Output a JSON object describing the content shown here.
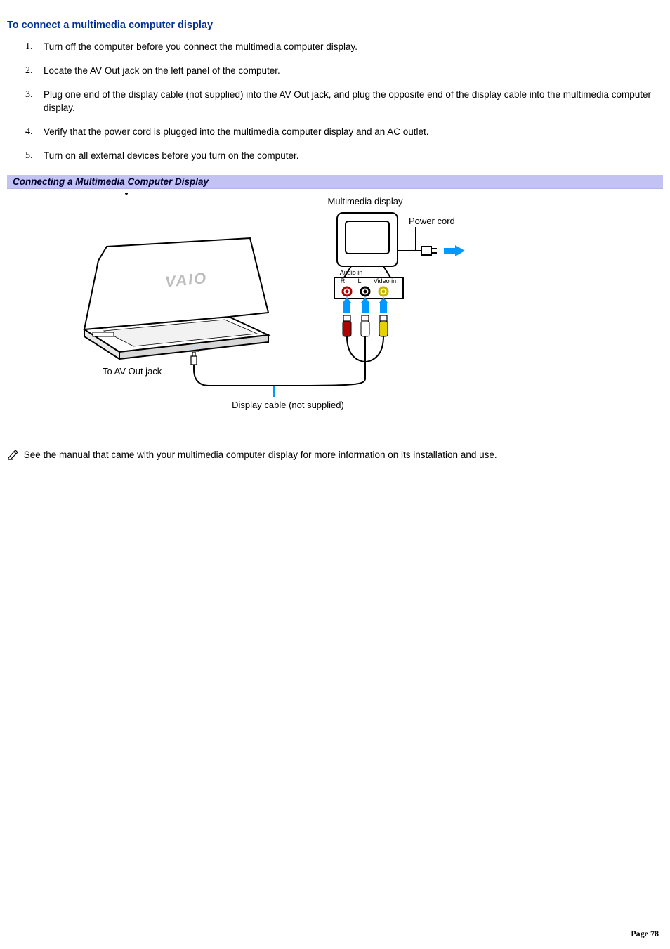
{
  "heading": "To connect a multimedia computer display",
  "steps": [
    "Turn off the computer before you connect the multimedia computer display.",
    "Locate the AV Out jack on the left panel of the computer.",
    "Plug one end of the display cable (not supplied) into the AV Out jack, and plug the opposite end of the display cable into the multimedia computer display.",
    "Verify that the power cord is plugged into the multimedia computer display and an AC outlet.",
    "Turn on all external devices before you turn on the computer."
  ],
  "caption": "Connecting a Multimedia Computer Display",
  "diagram": {
    "label_multimedia_display": "Multimedia display",
    "label_power_cord": "Power cord",
    "label_to_av_out": "To AV Out jack",
    "label_display_cable": "Display cable (not supplied)",
    "label_audio_in": "Audio in",
    "label_r": "R",
    "label_l": "L",
    "label_video_in": "Video in",
    "laptop_brand": "VAIO"
  },
  "note_text": "See the manual that came with your multimedia computer display for more information on its installation and use.",
  "page_label": "Page ",
  "page_number": "78"
}
